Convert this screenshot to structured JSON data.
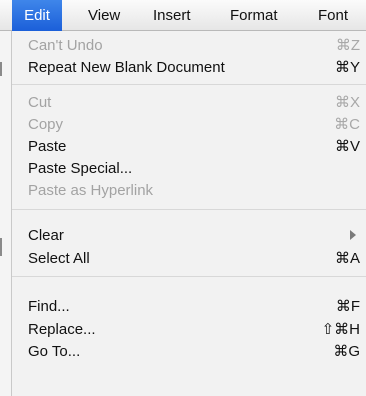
{
  "menubar": {
    "items": [
      "Edit",
      "View",
      "Insert",
      "Format",
      "Font"
    ],
    "active": "Edit"
  },
  "edit_menu": {
    "items": [
      {
        "label": "Can't Undo",
        "shortcut": "⌘Z",
        "enabled": false
      },
      {
        "label": "Repeat New Blank Document",
        "shortcut": "⌘Y",
        "enabled": true
      },
      {
        "label": "Cut",
        "shortcut": "⌘X",
        "enabled": false
      },
      {
        "label": "Copy",
        "shortcut": "⌘C",
        "enabled": false
      },
      {
        "label": "Paste",
        "shortcut": "⌘V",
        "enabled": true
      },
      {
        "label": "Paste Special...",
        "shortcut": "",
        "enabled": true
      },
      {
        "label": "Paste as Hyperlink",
        "shortcut": "",
        "enabled": false
      },
      {
        "label": "Clear",
        "shortcut": "",
        "enabled": true,
        "submenu": true
      },
      {
        "label": "Select All",
        "shortcut": "⌘A",
        "enabled": true
      },
      {
        "label": "Find...",
        "shortcut": "⌘F",
        "enabled": true
      },
      {
        "label": "Replace...",
        "shortcut": "⇧⌘H",
        "enabled": true
      },
      {
        "label": "Go To...",
        "shortcut": "⌘G",
        "enabled": true
      }
    ]
  },
  "colors": {
    "highlight": "#2a6fe0",
    "disabled_text": "#a3a3a3",
    "menu_background": "#f2f2f2"
  },
  "icons": {
    "submenu": "chevron-right-icon"
  }
}
